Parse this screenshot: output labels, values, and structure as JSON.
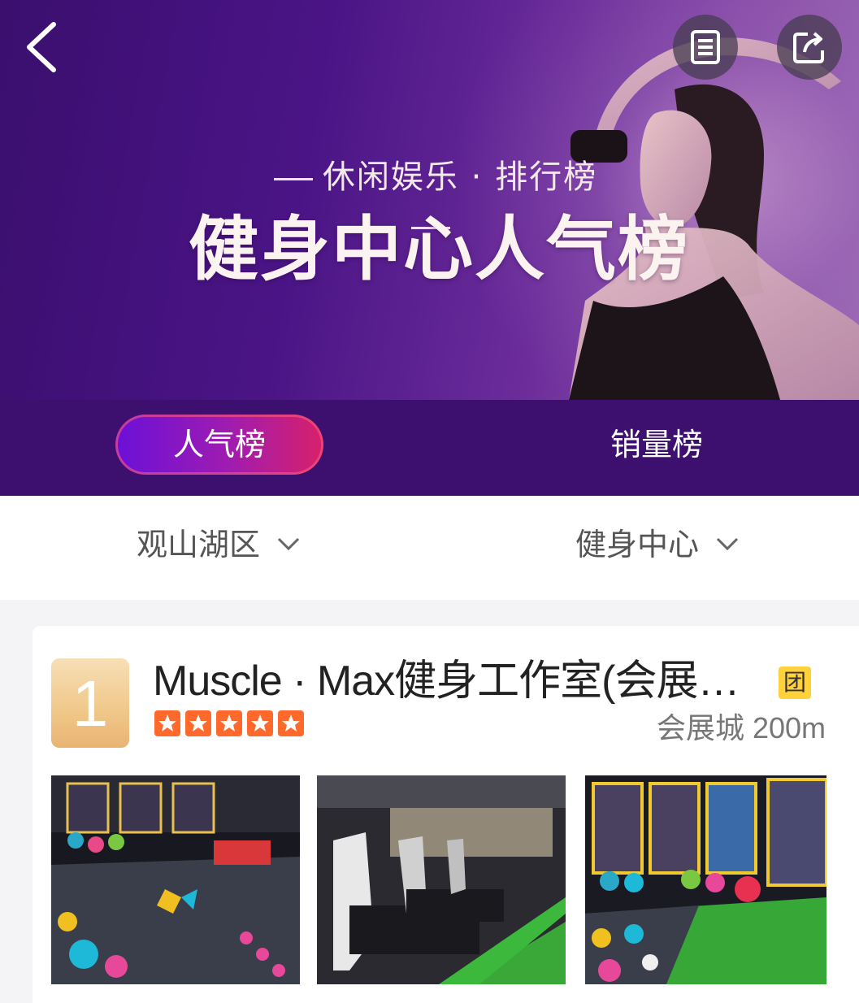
{
  "header": {
    "subtitle": "休闲娱乐 · 排行榜",
    "title": "健身中心人气榜",
    "back_icon": "chevron-left-icon",
    "actions": [
      {
        "name": "document-icon"
      },
      {
        "name": "share-icon"
      }
    ]
  },
  "tabs": [
    {
      "label": "人气榜",
      "active": true
    },
    {
      "label": "销量榜",
      "active": false
    }
  ],
  "filters": [
    {
      "label": "观山湖区"
    },
    {
      "label": "健身中心"
    }
  ],
  "listing": {
    "rank": "1",
    "name": "Muscle · Max健身工作室(会展…",
    "badge": "团",
    "rating": 5,
    "location": "会展城 200m",
    "photos": [
      "gym-floor-photo",
      "treadmill-photo",
      "gym-posters-photo"
    ]
  },
  "colors": {
    "hero_purple": "#3d0f6f",
    "active_tab_start": "#6a10d8",
    "active_tab_end": "#d8206a",
    "star_orange": "#ff6a2c",
    "badge_yellow": "#ffd23c",
    "rank_gold": "#f0c789"
  }
}
